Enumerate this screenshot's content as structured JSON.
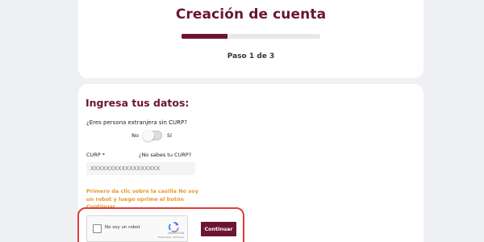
{
  "header": {
    "title": "Creación de cuenta",
    "progress": 0.33,
    "step": "Paso 1 de 3"
  },
  "form": {
    "title": "Ingresa tus datos:",
    "foreign_question": "¿Eres persona extranjera sin CURP?",
    "toggle_no": "No",
    "toggle_yes": "Sí",
    "curp_label": "CURP *",
    "curp_help": "¿No sabes tu CURP?",
    "curp_placeholder": "XXXXXXXXXXXXXXXXXX",
    "instruction": "Primero da clic sobre la casilla No soy un robot y luego oprime el botón Continuar"
  },
  "recaptcha": {
    "label": "No soy un robot",
    "brand": "reCAPTCHA",
    "links": "Privacidad - Términos"
  },
  "actions": {
    "continue_label": "Continuar"
  },
  "colors": {
    "brand": "#6b1530",
    "instruction": "#e39a2d",
    "highlight": "#dd3f37"
  }
}
